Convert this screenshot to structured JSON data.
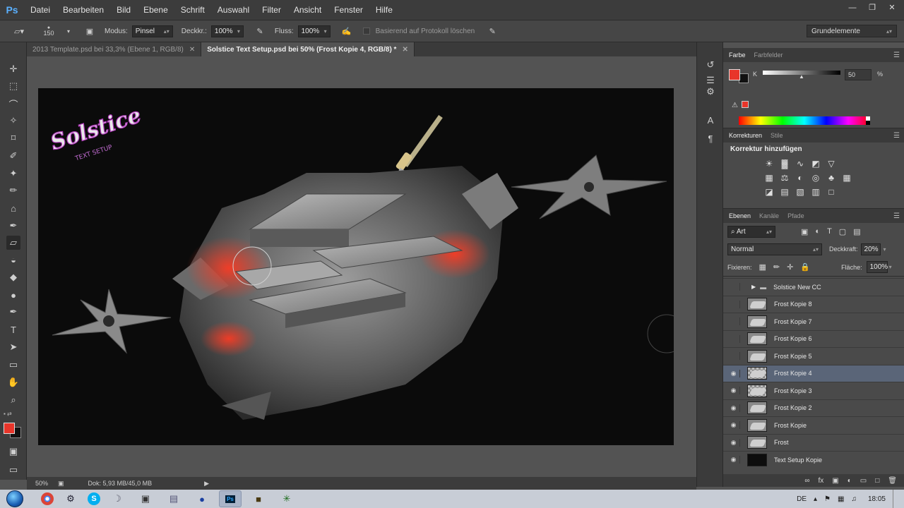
{
  "app": {
    "logo": "Ps"
  },
  "menu": [
    "Datei",
    "Bearbeiten",
    "Bild",
    "Ebene",
    "Schrift",
    "Auswahl",
    "Filter",
    "Ansicht",
    "Fenster",
    "Hilfe"
  ],
  "options": {
    "brush_size": "150",
    "mode_label": "Modus:",
    "mode_value": "Pinsel",
    "opacity_label": "Deckkr.:",
    "opacity_value": "100%",
    "flow_label": "Fluss:",
    "flow_value": "100%",
    "history_label": "Basierend auf Protokoll löschen",
    "workspace": "Grundelemente"
  },
  "tabs": [
    {
      "label": "2013 Template.psd bei 33,3% (Ebene 1, RGB/8)",
      "active": false
    },
    {
      "label": "Solstice Text Setup.psd bei 50% (Frost Kopie 4, RGB/8) *",
      "active": true
    }
  ],
  "status": {
    "zoom": "50%",
    "doc": "Dok: 5,93 MB/45,0 MB"
  },
  "canvas": {
    "logo_text": "Solstice",
    "logo_sub": "TEXT SETUP"
  },
  "panels": {
    "color_tabs": [
      "Farbe",
      "Farbfelder"
    ],
    "k_label": "K",
    "k_value": "50",
    "k_unit": "%",
    "adj_tabs": [
      "Korrekturen",
      "Stile"
    ],
    "adj_title": "Korrektur hinzufügen",
    "layer_tabs": [
      "Ebenen",
      "Kanäle",
      "Pfade"
    ],
    "filter_kind": "Art",
    "blend_mode": "Normal",
    "opacity_label": "Deckkraft:",
    "opacity_value": "20%",
    "lock_label": "Fixieren:",
    "fill_label": "Fläche:",
    "fill_value": "100%"
  },
  "layers": [
    {
      "name": "Solstice New CC",
      "visible": false,
      "type": "group",
      "selected": false
    },
    {
      "name": "Frost Kopie 8",
      "visible": false,
      "type": "image",
      "selected": false
    },
    {
      "name": "Frost Kopie 7",
      "visible": false,
      "type": "image",
      "selected": false
    },
    {
      "name": "Frost Kopie 6",
      "visible": false,
      "type": "image",
      "selected": false
    },
    {
      "name": "Frost Kopie 5",
      "visible": false,
      "type": "image",
      "selected": false
    },
    {
      "name": "Frost Kopie 4",
      "visible": true,
      "type": "check",
      "selected": true
    },
    {
      "name": "Frost Kopie 3",
      "visible": true,
      "type": "check",
      "selected": false
    },
    {
      "name": "Frost Kopie 2",
      "visible": true,
      "type": "image",
      "selected": false
    },
    {
      "name": "Frost Kopie",
      "visible": true,
      "type": "image",
      "selected": false
    },
    {
      "name": "Frost",
      "visible": true,
      "type": "image",
      "selected": false
    },
    {
      "name": "Text Setup Kopie",
      "visible": true,
      "type": "dark",
      "selected": false
    }
  ],
  "taskbar": {
    "lang": "DE",
    "time": "18:05"
  },
  "colors": {
    "foreground": "#e8352a",
    "background": "#111111",
    "selection": "#5a6578"
  }
}
